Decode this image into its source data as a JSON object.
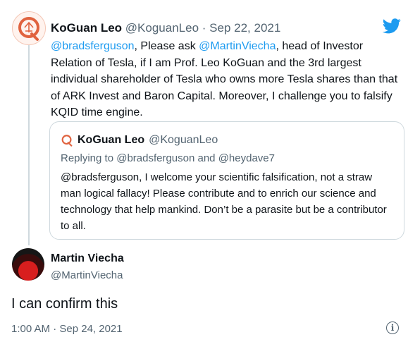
{
  "original_tweet": {
    "author_name": "KoGuan Leo",
    "author_handle": "@KoguanLeo",
    "separator": "·",
    "date": "Sep 22, 2021",
    "mention_1": "@bradsferguson",
    "text_1": ", Please ask ",
    "mention_2": "@MartinViecha",
    "text_2": ", head of Investor Relation of Tesla, if I am Prof. Leo KoGuan and the 3rd largest individual shareholder of Tesla who owns more Tesla shares than that of ARK Invest and Baron Capital. Moreover, I challenge you to falsify KQID time engine."
  },
  "quoted_tweet": {
    "author_name": "KoGuan Leo",
    "author_handle": "@KoguanLeo",
    "replying_to": "Replying to @bradsferguson and @heydave7",
    "text": "@bradsferguson, I welcome your scientific falsification, not  a straw man logical fallacy! Please contribute and to enrich our science and technology that help mankind. Don’t be a parasite but be a contributor to all."
  },
  "reply": {
    "author_name": "Martin Viecha",
    "author_handle": "@MartinViecha",
    "text": "I can confirm this",
    "timestamp": "1:00 AM · Sep 24, 2021"
  },
  "icons": {
    "brand": "twitter-bird-icon",
    "info": "info-icon",
    "info_glyph": "i"
  },
  "colors": {
    "link": "#1d9bf0",
    "muted": "#536471",
    "text": "#0f1419",
    "border": "#cfd9de",
    "brand": "#1d9bf0",
    "logo": "#e0633f"
  }
}
